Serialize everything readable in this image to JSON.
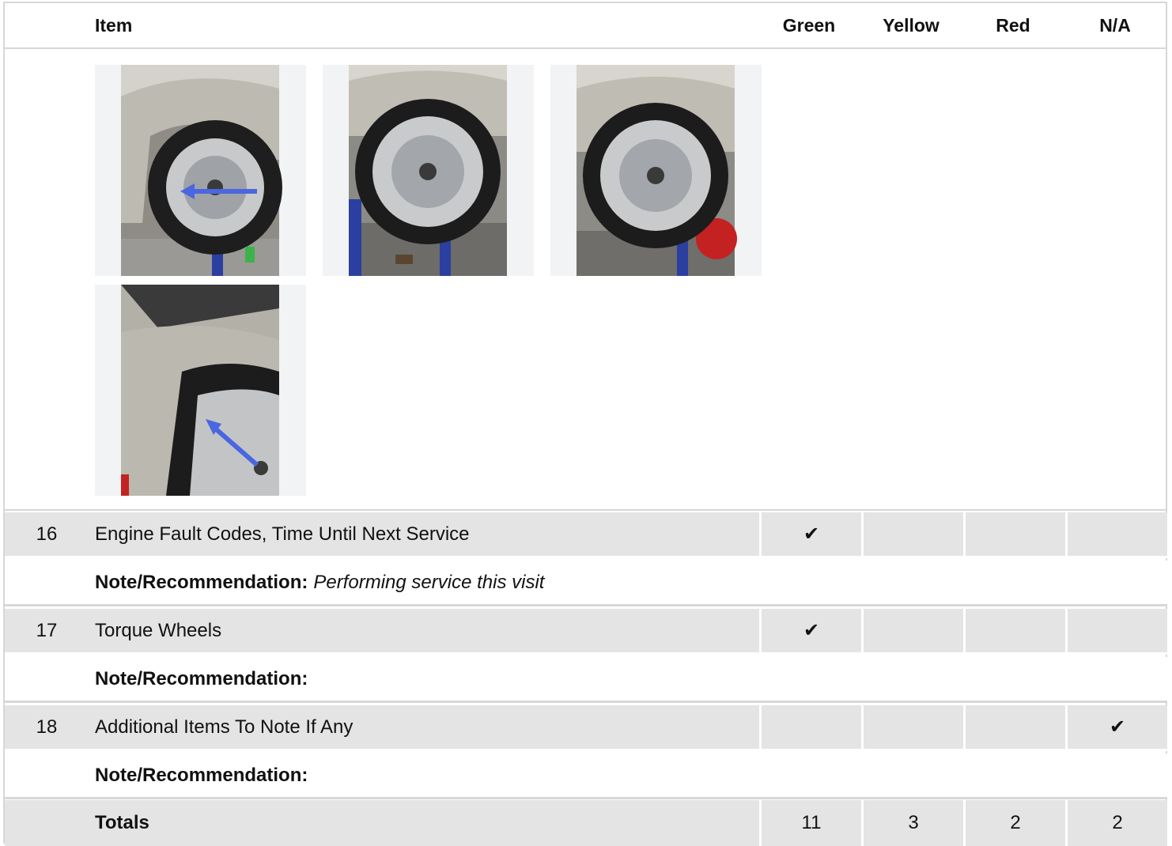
{
  "header": {
    "item_label": "Item",
    "green_label": "Green",
    "yellow_label": "Yellow",
    "red_label": "Red",
    "na_label": "N/A"
  },
  "photos": [
    {
      "name": "tire-photo-1-arrow"
    },
    {
      "name": "tire-photo-2"
    },
    {
      "name": "tire-photo-3"
    },
    {
      "name": "tire-photo-4-arrow"
    }
  ],
  "rows": [
    {
      "number": "16",
      "item": "Engine Fault Codes, Time Until Next Service",
      "green": "✔",
      "yellow": "",
      "red": "",
      "na": "",
      "note_label": "Note/Recommendation:",
      "note_text": "Performing service this visit"
    },
    {
      "number": "17",
      "item": "Torque Wheels",
      "green": "✔",
      "yellow": "",
      "red": "",
      "na": "",
      "note_label": "Note/Recommendation:",
      "note_text": ""
    },
    {
      "number": "18",
      "item": "Additional Items To Note If Any",
      "green": "",
      "yellow": "",
      "red": "",
      "na": "✔",
      "note_label": "Note/Recommendation:",
      "note_text": ""
    }
  ],
  "totals": {
    "label": "Totals",
    "green": "11",
    "yellow": "3",
    "red": "2",
    "na": "2"
  },
  "colors": {
    "row_gray": "#e4e4e4",
    "border": "#d7d7d7",
    "arrow": "#4a66e0",
    "car_silver": "#b9b6ae"
  }
}
